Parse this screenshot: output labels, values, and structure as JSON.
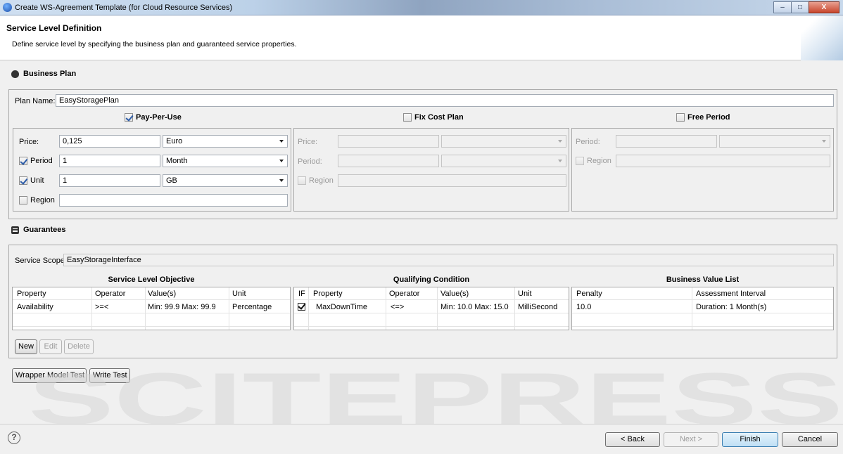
{
  "window": {
    "title": "Create WS-Agreement Template (for Cloud Resource Services)",
    "minimize": "–",
    "maximize": "□",
    "close": "X"
  },
  "header": {
    "title": "Service Level Definition",
    "description": "Define service level by specifying the business plan and guaranteed service properties."
  },
  "business_plan": {
    "section_title": "Business Plan",
    "plan_name_label": "Plan Name:",
    "plan_name_value": "EasyStoragePlan",
    "pay_per_use": {
      "label": "Pay-Per-Use",
      "checked": true,
      "price_label": "Price:",
      "price_value": "0,125",
      "price_unit": "Euro",
      "period_label": "Period",
      "period_value": "1",
      "period_unit": "Month",
      "unit_label": "Unit",
      "unit_value": "1",
      "unit_unit": "GB",
      "region_label": "Region",
      "region_value": ""
    },
    "fix_cost_plan": {
      "label": "Fix Cost Plan",
      "checked": false,
      "price_label": "Price:",
      "period_label": "Period:",
      "region_label": "Region"
    },
    "free_period": {
      "label": "Free Period",
      "checked": false,
      "period_label": "Period:",
      "region_label": "Region"
    }
  },
  "guarantees": {
    "section_title": "Guarantees",
    "service_scope_label": "Service Scope:",
    "service_scope_value": "EasyStorageInterface",
    "slo": {
      "title": "Service Level Objective",
      "columns": [
        "Property",
        "Operator",
        "Value(s)",
        "Unit"
      ],
      "rows": [
        [
          "Availability",
          ">=<",
          "Min: 99.9  Max: 99.9",
          "Percentage"
        ]
      ]
    },
    "qc": {
      "title": "Qualifying Condition",
      "columns": [
        "IF",
        "Property",
        "Operator",
        "Value(s)",
        "Unit"
      ],
      "rows": [
        [
          "MaxDownTime",
          "<=>",
          "Min: 10.0  Max: 15.0",
          "MilliSecond"
        ]
      ]
    },
    "bvl": {
      "title": "Business Value List",
      "columns": [
        "Penalty",
        "Assessment Interval"
      ],
      "rows": [
        [
          "10.0",
          "Duration:  1 Month(s)"
        ]
      ]
    },
    "buttons": {
      "new": "New",
      "edit": "Edit",
      "delete": "Delete"
    }
  },
  "test_buttons": {
    "wrapper": "Wrapper Model Test",
    "write": "Write Test"
  },
  "watermark": {
    "text": "SCITEPRESS"
  },
  "footer": {
    "help": "?",
    "back": "< Back",
    "next": "Next >",
    "finish": "Finish",
    "cancel": "Cancel"
  }
}
